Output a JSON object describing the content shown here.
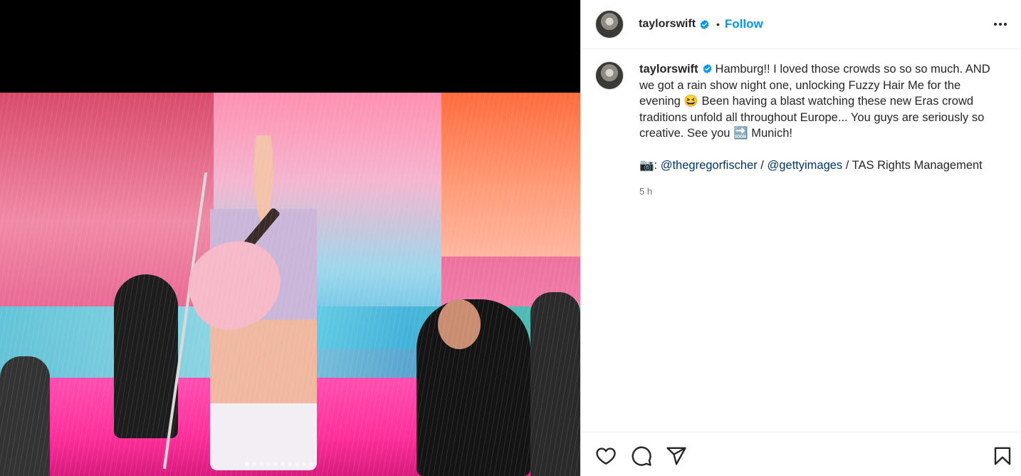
{
  "post": {
    "username": "taylorswift",
    "follow_label": "Follow",
    "bullet": "•",
    "caption": "Hamburg!! I loved those crowds so so so much. AND we got a rain show night one, unlocking Fuzzy Hair Me for the evening 😆 Been having a blast watching these new Eras crowd traditions unfold all throughout Europe... You guys are seriously so creative. See you 🔜 Munich!",
    "credit": {
      "camera_emoji": "📷",
      "colon": ": ",
      "mention1": "@thegregorfischer",
      "sep1": " / ",
      "mention2": "@gettyimages",
      "tail": " / TAS Rights Management"
    },
    "timestamp": "5 h"
  },
  "media": {
    "carousel_count": 10,
    "active_index": 0
  },
  "colors": {
    "follow": "#0095f6",
    "verified": "#0095f6",
    "mention": "#00376b",
    "timestamp": "#737373"
  },
  "icons": [
    "verified-badge-icon",
    "more-options-icon",
    "heart-icon",
    "comment-icon",
    "share-icon",
    "bookmark-icon"
  ]
}
